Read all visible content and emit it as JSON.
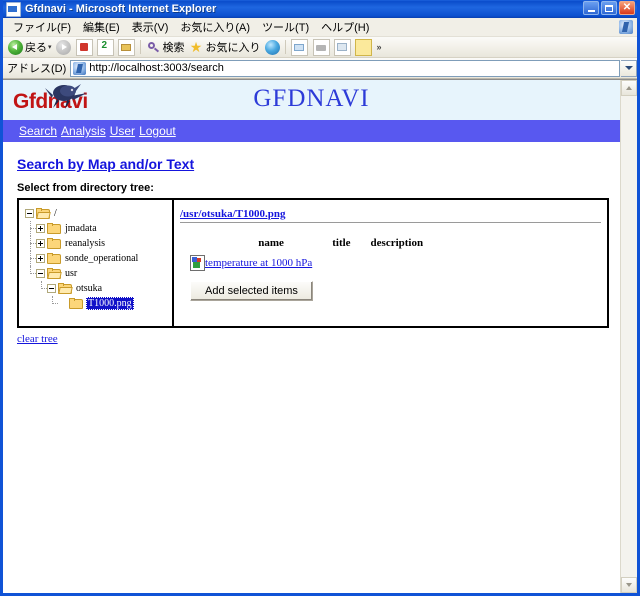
{
  "window": {
    "title": "Gfdnavi - Microsoft Internet Explorer",
    "app_icon": "ie-document-icon",
    "buttons": {
      "minimize": "minimize-button",
      "maximize": "maximize-button",
      "close": "close-button",
      "close_glyph": "✕"
    }
  },
  "menubar": {
    "items": [
      {
        "label": "ファイル(F)",
        "name": "menu-file"
      },
      {
        "label": "編集(E)",
        "name": "menu-edit"
      },
      {
        "label": "表示(V)",
        "name": "menu-view"
      },
      {
        "label": "お気に入り(A)",
        "name": "menu-favorites"
      },
      {
        "label": "ツール(T)",
        "name": "menu-tools"
      },
      {
        "label": "ヘルプ(H)",
        "name": "menu-help"
      }
    ]
  },
  "toolbar": {
    "back_label": "戻る",
    "search_label": "検索",
    "favorites_label": "お気に入り",
    "overflow_glyph": "»",
    "dropdown_glyph": "▾"
  },
  "addressbar": {
    "label": "アドレス(D)",
    "url": "http://localhost:3003/search"
  },
  "site": {
    "logo_text": "Gfdnavi",
    "title": "GFDNAVI",
    "nav": [
      {
        "label": "Search",
        "name": "nav-search"
      },
      {
        "label": "Analysis",
        "name": "nav-analysis"
      },
      {
        "label": "User",
        "name": "nav-user"
      },
      {
        "label": "Logout",
        "name": "nav-logout"
      }
    ]
  },
  "content": {
    "heading": "Search by Map and/or Text",
    "sub_label": "Select from directory tree:",
    "clear_tree": "clear tree",
    "tree": [
      {
        "label": "/",
        "depth": 0,
        "toggle": "minus",
        "folder": "open",
        "guide": "none",
        "selected": false
      },
      {
        "label": "jmadata",
        "depth": 1,
        "toggle": "plus",
        "folder": "closed",
        "guide": "tee",
        "selected": false
      },
      {
        "label": "reanalysis",
        "depth": 1,
        "toggle": "plus",
        "folder": "closed",
        "guide": "tee",
        "selected": false
      },
      {
        "label": "sonde_operational",
        "depth": 1,
        "toggle": "plus",
        "folder": "closed",
        "guide": "tee",
        "selected": false
      },
      {
        "label": "usr",
        "depth": 1,
        "toggle": "minus",
        "folder": "open",
        "guide": "ell",
        "selected": false
      },
      {
        "label": "otsuka",
        "depth": 2,
        "toggle": "minus",
        "folder": "open",
        "guide": "ell",
        "selected": false
      },
      {
        "label": "T1000.png",
        "depth": 3,
        "toggle": "none",
        "folder": "closed",
        "guide": "ell",
        "selected": true
      }
    ],
    "detail": {
      "path": "/usr/otsuka/T1000.png",
      "columns": [
        "name",
        "title",
        "description"
      ],
      "rows": [
        {
          "icon": "image-file-icon",
          "name": "temperature at 1000 hPa",
          "title": "",
          "description": ""
        }
      ],
      "add_button": "Add selected items"
    }
  },
  "colors": {
    "nav_bar": "#5858f0",
    "header_bg": "#e7f4fc",
    "logo_red": "#c11414",
    "title_blue": "#2d3bd8",
    "link_blue": "#1515dd",
    "selection_blue": "#1010c8",
    "titlebar_blue": "#0a4ccb"
  }
}
